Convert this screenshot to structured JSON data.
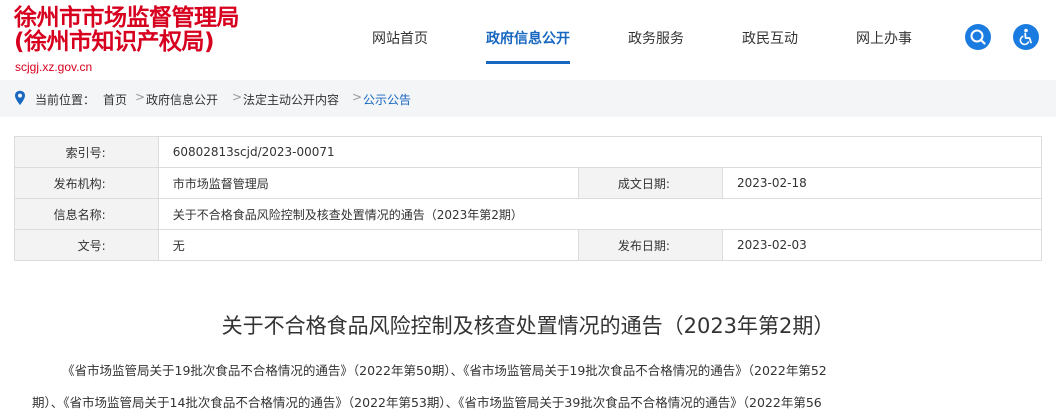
{
  "header": {
    "logo_line1": "徐州市市场监督管理局",
    "logo_line2": "(徐州市知识产权局)",
    "logo_url": "scjgj.xz.gov.cn",
    "brand_color": "#d7001e",
    "accent_color": "#1867c0"
  },
  "nav": {
    "items": [
      {
        "label": "网站首页",
        "active": false
      },
      {
        "label": "政府信息公开",
        "active": true
      },
      {
        "label": "政务服务",
        "active": false
      },
      {
        "label": "政民互动",
        "active": false
      },
      {
        "label": "网上办事",
        "active": false
      }
    ],
    "search_icon": "search-icon",
    "accessibility_icon": "wheelchair-icon"
  },
  "breadcrumb": {
    "prefix": "当前位置：",
    "items": [
      "首页",
      "政府信息公开",
      "法定主动公开内容",
      "公示公告"
    ],
    "separator": ">"
  },
  "info": {
    "index_label": "索引号:",
    "index_value": "60802813scjd/2023-00071",
    "org_label": "发布机构:",
    "org_value": "市市场监督管理局",
    "made_date_label": "成文日期:",
    "made_date_value": "2023-02-18",
    "name_label": "信息名称:",
    "name_value": "关于不合格食品风险控制及核查处置情况的通告（2023年第2期）",
    "doc_no_label": "文号:",
    "doc_no_value": "无",
    "pub_date_label": "发布日期:",
    "pub_date_value": "2023-02-03"
  },
  "article": {
    "title": "关于不合格食品风险控制及核查处置情况的通告（2023年第2期）",
    "line1": "《省市场监管局关于19批次食品不合格情况的通告》（2022年第50期）、《省市场监管局关于19批次食品不合格情况的通告》（2022年第52",
    "line2": "期）、《省市场监管局关于14批次食品不合格情况的通告》（2022年第53期）、《省市场监管局关于39批次食品不合格情况的通告》（2022年第56"
  }
}
